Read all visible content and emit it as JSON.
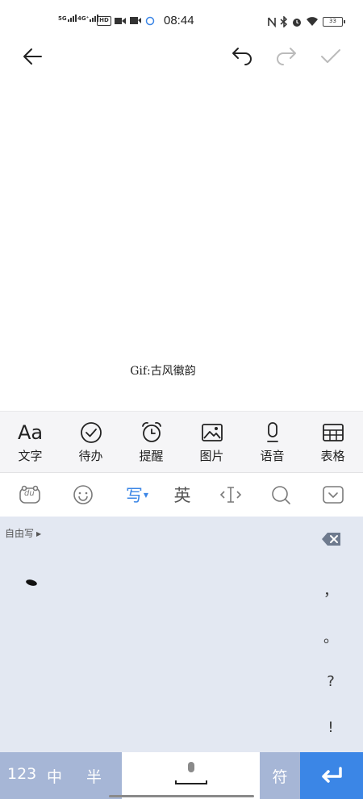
{
  "status_bar": {
    "network1": "5G",
    "network2": "4G⁺",
    "hd": "HD",
    "time": "08:44",
    "battery": "33"
  },
  "toolbar": {
    "back_icon": "arrow-left-icon",
    "undo_icon": "undo-icon",
    "redo_icon": "redo-icon",
    "confirm_icon": "check-icon"
  },
  "editor": {
    "caption": "Gif:古风徽韵"
  },
  "format_bar": {
    "items": [
      {
        "label": "文字",
        "glyph": "Aa",
        "icon": "text-format-icon"
      },
      {
        "label": "待办",
        "icon": "todo-check-icon"
      },
      {
        "label": "提醒",
        "icon": "alarm-clock-icon"
      },
      {
        "label": "图片",
        "icon": "image-icon"
      },
      {
        "label": "语音",
        "icon": "microphone-icon"
      },
      {
        "label": "表格",
        "icon": "table-icon"
      }
    ]
  },
  "keyboard_toolbar": {
    "logo_text": "du",
    "write_label": "写",
    "english_label": "英"
  },
  "handwriting": {
    "mode_label": "自由写",
    "punctuation": [
      "，",
      "。",
      "?",
      "!"
    ]
  },
  "bottom_row": {
    "num_label": "123",
    "zh_label": "中",
    "half_label": "半",
    "symbol_label": "符"
  },
  "colors": {
    "accent_blue": "#3b86e6",
    "key_grey_blue": "#a6b6d6",
    "handwriting_bg": "#e3e8f2"
  }
}
